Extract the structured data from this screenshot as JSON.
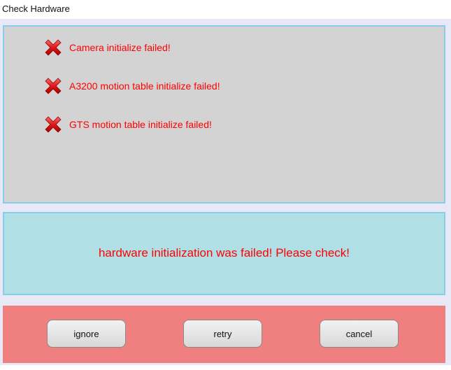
{
  "window": {
    "title": "Check Hardware"
  },
  "errors": [
    {
      "icon": "error-x-icon",
      "message": "Camera initialize failed!"
    },
    {
      "icon": "error-x-icon",
      "message": "A3200 motion table initialize failed!"
    },
    {
      "icon": "error-x-icon",
      "message": "GTS motion table initialize failed!"
    }
  ],
  "summary": {
    "message": "hardware initialization was failed! Please check!"
  },
  "buttons": {
    "ignore_label": "ignore",
    "retry_label": "retry",
    "cancel_label": "cancel"
  },
  "colors": {
    "error_text": "#ff0000",
    "error_panel_bg": "#d3d3d3",
    "summary_panel_bg": "#b0e0e6",
    "button_panel_bg": "#f08080",
    "panel_border": "#87ceeb"
  }
}
